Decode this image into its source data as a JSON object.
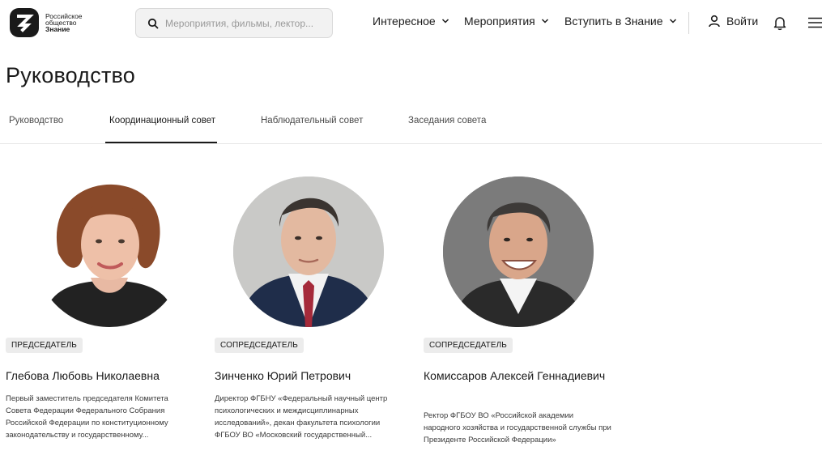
{
  "header": {
    "logo": {
      "line1": "Российское",
      "line2": "общество",
      "line3": "Знание",
      "icon": "znanie-logo-icon"
    },
    "search": {
      "placeholder": "Мероприятия, фильмы, лектор...",
      "value": "",
      "icon": "search-icon"
    },
    "nav": [
      {
        "label": "Интересное",
        "icon": "chevron-down-icon"
      },
      {
        "label": "Мероприятия",
        "icon": "chevron-down-icon"
      },
      {
        "label": "Вступить в Знание",
        "icon": "chevron-down-icon"
      }
    ],
    "login_label": "Войти",
    "icons": {
      "login": "user-icon",
      "notifications": "bell-icon",
      "menu": "hamburger-menu-icon"
    }
  },
  "page": {
    "title": "Руководство"
  },
  "tabs": [
    {
      "label": "Руководство",
      "active": false
    },
    {
      "label": "Координационный совет",
      "active": true
    },
    {
      "label": "Наблюдательный совет",
      "active": false
    },
    {
      "label": "Заседания совета",
      "active": false
    }
  ],
  "members": [
    {
      "role": "ПРЕДСЕДАТЕЛЬ",
      "name": "Глебова Любовь Николаевна",
      "description": "Первый заместитель председателя Комитета Совета Федерации Федерального Собрания Российской Федерации по конституционному законодательству и государственному..."
    },
    {
      "role": "СОПРЕДСЕДАТЕЛЬ",
      "name": "Зинченко Юрий Петрович",
      "description": "Директор ФГБНУ «Федеральный научный центр психологических и междисциплинарных исследований», декан факультета психологии ФГБОУ ВО «Московский государственный..."
    },
    {
      "role": "СОПРЕДСЕДАТЕЛЬ",
      "name": "Комиссаров Алексей Геннадиевич",
      "description": "Ректор ФГБОУ ВО «Российской академии народного хозяйства и государственной службы при Президенте Российской Федерации»"
    }
  ],
  "colors": {
    "text": "#1a1a1a",
    "badge_bg": "#ececec",
    "search_bg": "#f2f2f2",
    "tab_underline": "#1a1a1a"
  }
}
